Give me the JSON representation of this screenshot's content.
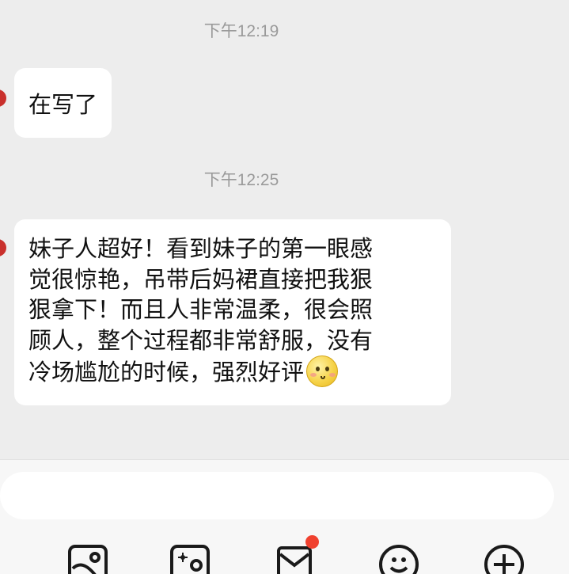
{
  "messages": [
    {
      "timestamp": "下午12:19",
      "text": "在写了"
    },
    {
      "timestamp": "下午12:25",
      "lines": [
        "妹子人超好！看到妹子的第一眼感",
        "觉很惊艳，吊带后妈裙直接把我狠",
        "狠拿下！而且人非常温柔，很会照",
        "顾人，整个过程都非常舒服，没有",
        "冷场尴尬的时候，强烈好评"
      ],
      "trailing_emoji": "smiling-face-emoji"
    }
  ],
  "input": {
    "value": "",
    "placeholder": ""
  },
  "toolbar": {
    "icons": [
      "image-icon",
      "camera-icon",
      "red-packet-icon",
      "emoji-icon",
      "plus-icon"
    ],
    "red_packet_badge": true
  },
  "colors": {
    "background": "#ededed",
    "bubble": "#ffffff",
    "timestamp": "#9a9a9a",
    "badge": "#f0412f"
  }
}
